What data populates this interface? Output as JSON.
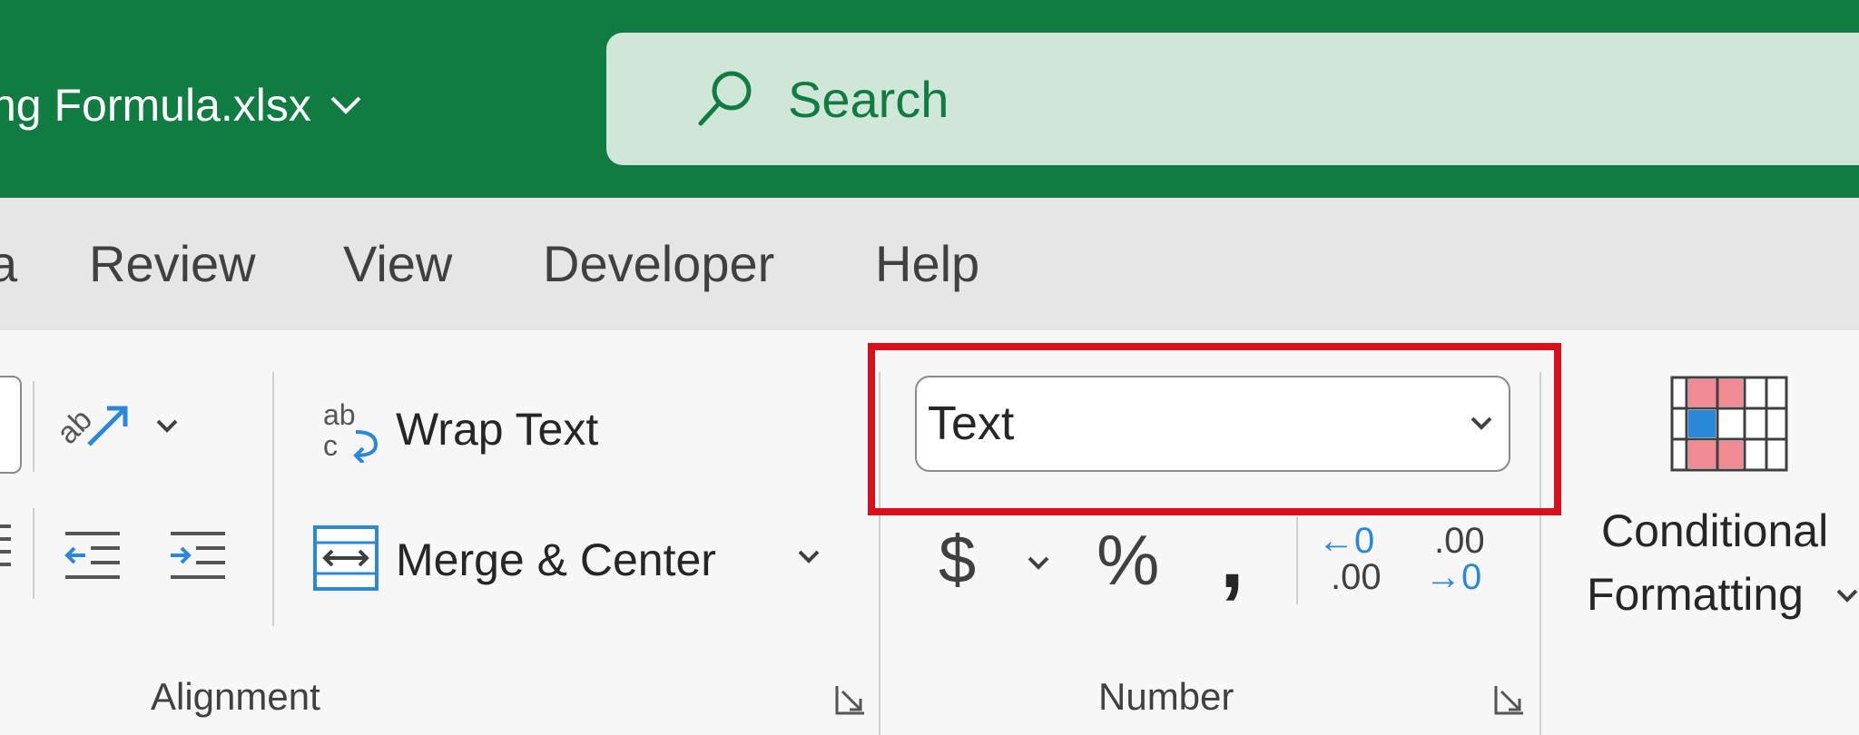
{
  "app": {
    "document_title": "ng Formula.xlsx",
    "search": {
      "placeholder": "Search"
    }
  },
  "tabs": [
    {
      "label": "a"
    },
    {
      "label": "Review"
    },
    {
      "label": "View"
    },
    {
      "label": "Developer"
    },
    {
      "label": "Help"
    }
  ],
  "alignment_group": {
    "label": "Alignment",
    "wrap_text_label": "Wrap Text",
    "merge_center_label": "Merge & Center",
    "wrap_icon_glyph": "ab c"
  },
  "number_group": {
    "label": "Number",
    "format_value": "Text",
    "currency_symbol": "$",
    "percent_symbol": "%",
    "comma_symbol": ",",
    "increase_decimal": {
      "top": "←0",
      "bottom": ".00"
    },
    "decrease_decimal": {
      "top": ".00",
      "bottom": "→0"
    }
  },
  "styles_group": {
    "conditional_formatting_line1": "Conditional",
    "conditional_formatting_line2": "Formatting"
  },
  "colors": {
    "excel_green": "#107c41",
    "search_bg": "#cfe6d8",
    "tab_bar": "#e6e6e6",
    "ribbon": "#f7f7f7",
    "highlight_red": "#d8101c",
    "accent_blue": "#2b88d8",
    "cf_red": "#f08a93"
  },
  "icons": [
    "chevron-down-icon",
    "search-icon",
    "orientation-icon",
    "wrap-text-icon",
    "decrease-indent-icon",
    "increase-indent-icon",
    "merge-center-icon",
    "dialog-launcher-icon",
    "conditional-formatting-icon"
  ]
}
